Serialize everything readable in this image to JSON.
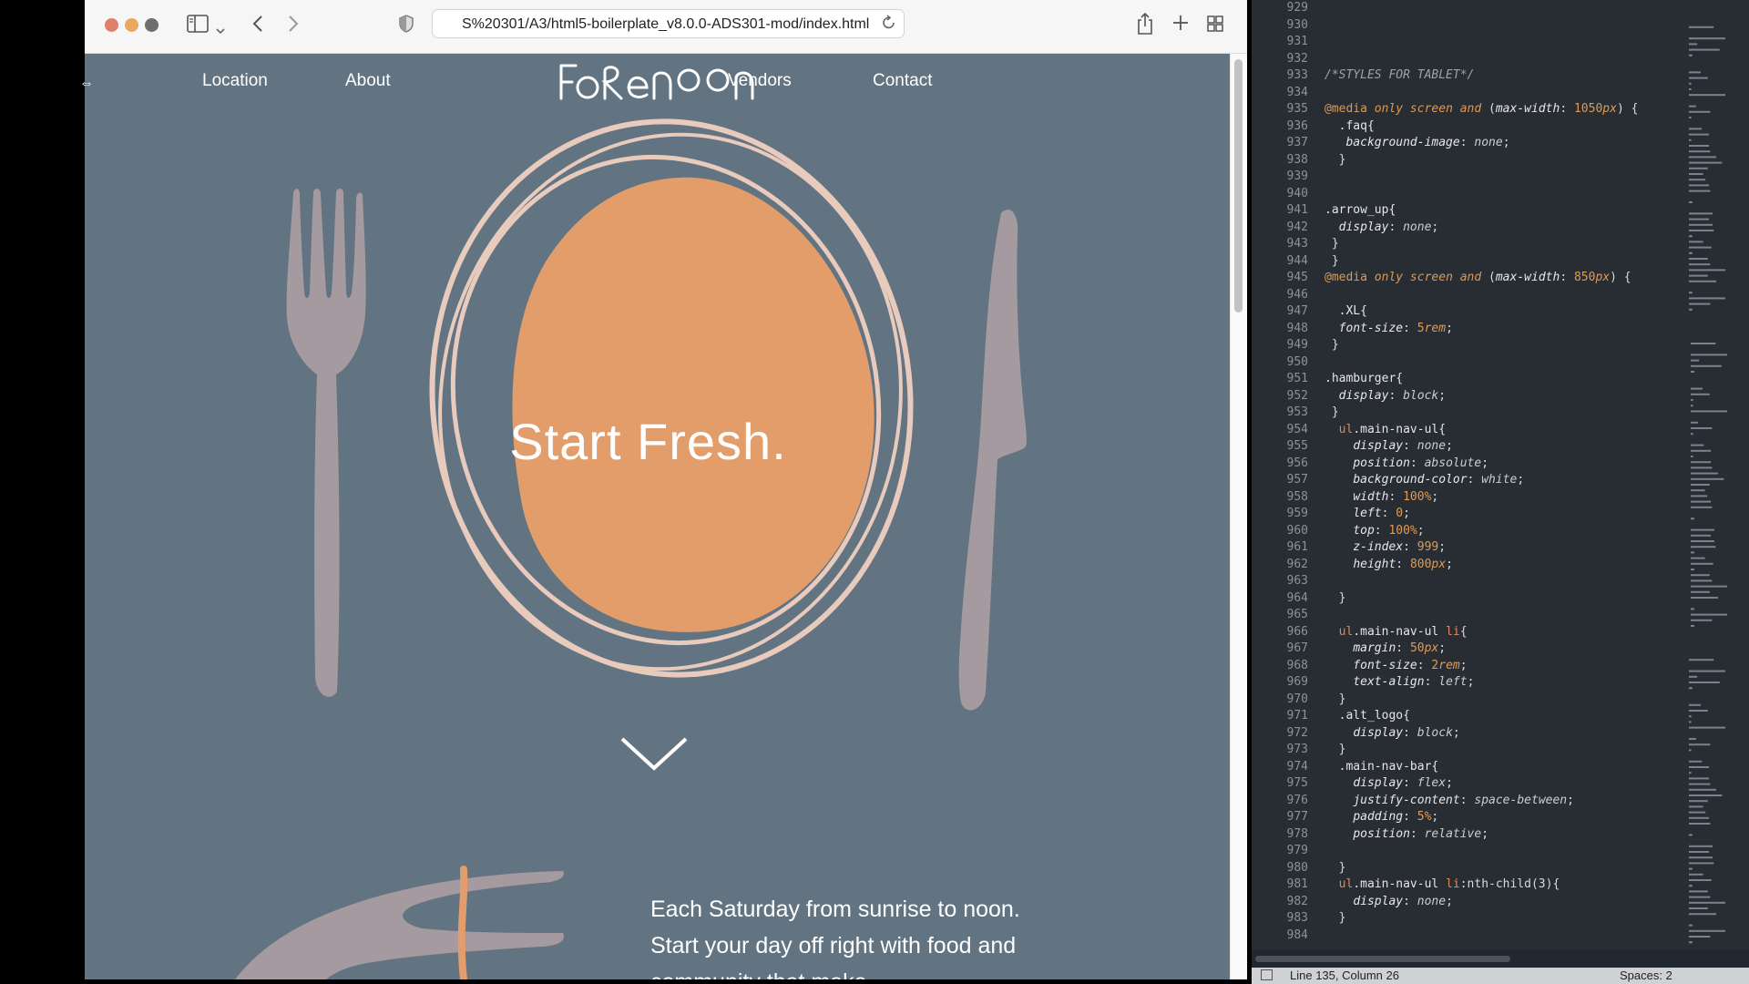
{
  "browser": {
    "url": "S%20301/A3/html5-boilerplate_v8.0.0-ADS301-mod/index.html",
    "traffic_colors": [
      "#e0806b",
      "#e9a85e",
      "#6e6e6e"
    ],
    "icons": {
      "sidebar": "sidebar-icon",
      "back": "chevron-left-icon",
      "forward": "chevron-right-icon",
      "privacy": "shield-icon",
      "reload": "reload-icon",
      "share": "share-icon",
      "new_tab": "plus-icon",
      "tabs": "grid-icon"
    }
  },
  "site": {
    "nav": {
      "location": "Location",
      "about": "About",
      "vendors": "Vendors",
      "contact": "Contact"
    },
    "logo_text": "FoReNoon",
    "hero_title": "Start Fresh.",
    "intro_text": "Each Saturday from sunrise to noon. Start your day off right with food and community that make",
    "colors": {
      "background": "#627482",
      "accent": "#e39d6b",
      "cutlery": "#a59a9f",
      "plate": "#e9cbbd"
    }
  },
  "editor": {
    "lines": [
      {
        "n": "929",
        "c": []
      },
      {
        "n": "930",
        "c": []
      },
      {
        "n": "931",
        "c": []
      },
      {
        "n": "932",
        "c": []
      },
      {
        "n": "933",
        "c": [
          [
            "c-com",
            "/*STYLES FOR TABLET*/"
          ]
        ]
      },
      {
        "n": "934",
        "c": []
      },
      {
        "n": "935",
        "c": [
          [
            "c-at",
            "@media "
          ],
          [
            "c-kw",
            "only screen and "
          ],
          [
            "",
            "("
          ],
          [
            "c-prop",
            "max-width"
          ],
          [
            "",
            ": "
          ],
          [
            "c-num",
            "1050"
          ],
          [
            "c-unit",
            "px"
          ],
          [
            "",
            ") {"
          ]
        ]
      },
      {
        "n": "936",
        "c": [
          [
            "c-sel",
            "  .faq{"
          ]
        ]
      },
      {
        "n": "937",
        "c": [
          [
            "",
            "   "
          ],
          [
            "c-prop",
            "background-image"
          ],
          [
            "",
            ": "
          ],
          [
            "c-val",
            "none"
          ],
          [
            "",
            ";"
          ]
        ]
      },
      {
        "n": "938",
        "c": [
          [
            "",
            "  }"
          ]
        ]
      },
      {
        "n": "939",
        "c": []
      },
      {
        "n": "940",
        "c": []
      },
      {
        "n": "941",
        "c": [
          [
            "c-sel",
            ".arrow_up{"
          ]
        ]
      },
      {
        "n": "942",
        "c": [
          [
            "",
            "  "
          ],
          [
            "c-prop",
            "display"
          ],
          [
            "",
            ": "
          ],
          [
            "c-val",
            "none"
          ],
          [
            "",
            ";"
          ]
        ]
      },
      {
        "n": "943",
        "c": [
          [
            "",
            " }"
          ]
        ]
      },
      {
        "n": "944",
        "c": [
          [
            "",
            " }"
          ]
        ]
      },
      {
        "n": "945",
        "c": [
          [
            "c-at",
            "@media "
          ],
          [
            "c-kw",
            "only screen and "
          ],
          [
            "",
            "("
          ],
          [
            "c-prop",
            "max-width"
          ],
          [
            "",
            ": "
          ],
          [
            "c-num",
            "850"
          ],
          [
            "c-unit",
            "px"
          ],
          [
            "",
            ") {"
          ]
        ]
      },
      {
        "n": "946",
        "c": []
      },
      {
        "n": "947",
        "c": [
          [
            "c-sel",
            "  .XL{"
          ]
        ]
      },
      {
        "n": "948",
        "c": [
          [
            "",
            "  "
          ],
          [
            "c-prop",
            "font-size"
          ],
          [
            "",
            ": "
          ],
          [
            "c-num",
            "5"
          ],
          [
            "c-unit",
            "rem"
          ],
          [
            "",
            ";"
          ]
        ]
      },
      {
        "n": "949",
        "c": [
          [
            "",
            " }"
          ]
        ]
      },
      {
        "n": "950",
        "c": []
      },
      {
        "n": "951",
        "c": [
          [
            "c-sel",
            ".hamburger{"
          ]
        ]
      },
      {
        "n": "952",
        "c": [
          [
            "",
            "  "
          ],
          [
            "c-prop",
            "display"
          ],
          [
            "",
            ": "
          ],
          [
            "c-val",
            "block"
          ],
          [
            "",
            ";"
          ]
        ]
      },
      {
        "n": "953",
        "c": [
          [
            "",
            " }"
          ]
        ]
      },
      {
        "n": "954",
        "c": [
          [
            "c-tag",
            "  ul"
          ],
          [
            "c-sel",
            ".main-nav-ul{"
          ]
        ]
      },
      {
        "n": "955",
        "c": [
          [
            "",
            "    "
          ],
          [
            "c-prop",
            "display"
          ],
          [
            "",
            ": "
          ],
          [
            "c-val",
            "none"
          ],
          [
            "",
            ";"
          ]
        ]
      },
      {
        "n": "956",
        "c": [
          [
            "",
            "    "
          ],
          [
            "c-prop",
            "position"
          ],
          [
            "",
            ": "
          ],
          [
            "c-val",
            "absolute"
          ],
          [
            "",
            ";"
          ]
        ]
      },
      {
        "n": "957",
        "c": [
          [
            "",
            "    "
          ],
          [
            "c-prop",
            "background-color"
          ],
          [
            "",
            ": "
          ],
          [
            "c-val",
            "white"
          ],
          [
            "",
            ";"
          ]
        ]
      },
      {
        "n": "958",
        "c": [
          [
            "",
            "    "
          ],
          [
            "c-prop",
            "width"
          ],
          [
            "",
            ": "
          ],
          [
            "c-num",
            "100"
          ],
          [
            "c-unit",
            "%"
          ],
          [
            "",
            ";"
          ]
        ]
      },
      {
        "n": "959",
        "c": [
          [
            "",
            "    "
          ],
          [
            "c-prop",
            "left"
          ],
          [
            "",
            ": "
          ],
          [
            "c-num",
            "0"
          ],
          [
            "",
            ";"
          ]
        ]
      },
      {
        "n": "960",
        "c": [
          [
            "",
            "    "
          ],
          [
            "c-prop",
            "top"
          ],
          [
            "",
            ": "
          ],
          [
            "c-num",
            "100"
          ],
          [
            "c-unit",
            "%"
          ],
          [
            "",
            ";"
          ]
        ]
      },
      {
        "n": "961",
        "c": [
          [
            "",
            "    "
          ],
          [
            "c-prop",
            "z-index"
          ],
          [
            "",
            ": "
          ],
          [
            "c-num",
            "999"
          ],
          [
            "",
            ";"
          ]
        ]
      },
      {
        "n": "962",
        "c": [
          [
            "",
            "    "
          ],
          [
            "c-prop",
            "height"
          ],
          [
            "",
            ": "
          ],
          [
            "c-num",
            "800"
          ],
          [
            "c-unit",
            "px"
          ],
          [
            "",
            ";"
          ]
        ]
      },
      {
        "n": "963",
        "c": []
      },
      {
        "n": "964",
        "c": [
          [
            "",
            "  }"
          ]
        ]
      },
      {
        "n": "965",
        "c": []
      },
      {
        "n": "966",
        "c": [
          [
            "c-tag",
            "  ul"
          ],
          [
            "c-sel",
            ".main-nav-ul "
          ],
          [
            "c-tag",
            "li"
          ],
          [
            "",
            "{"
          ]
        ]
      },
      {
        "n": "967",
        "c": [
          [
            "",
            "    "
          ],
          [
            "c-prop",
            "margin"
          ],
          [
            "",
            ": "
          ],
          [
            "c-num",
            "50"
          ],
          [
            "c-unit",
            "px"
          ],
          [
            "",
            ";"
          ]
        ]
      },
      {
        "n": "968",
        "c": [
          [
            "",
            "    "
          ],
          [
            "c-prop",
            "font-size"
          ],
          [
            "",
            ": "
          ],
          [
            "c-num",
            "2"
          ],
          [
            "c-unit",
            "rem"
          ],
          [
            "",
            ";"
          ]
        ]
      },
      {
        "n": "969",
        "c": [
          [
            "",
            "    "
          ],
          [
            "c-prop",
            "text-align"
          ],
          [
            "",
            ": "
          ],
          [
            "c-val",
            "left"
          ],
          [
            "",
            ";"
          ]
        ]
      },
      {
        "n": "970",
        "c": [
          [
            "",
            "  }"
          ]
        ]
      },
      {
        "n": "971",
        "c": [
          [
            "c-sel",
            "  .alt_logo{"
          ]
        ]
      },
      {
        "n": "972",
        "c": [
          [
            "",
            "    "
          ],
          [
            "c-prop",
            "display"
          ],
          [
            "",
            ": "
          ],
          [
            "c-val",
            "block"
          ],
          [
            "",
            ";"
          ]
        ]
      },
      {
        "n": "973",
        "c": [
          [
            "",
            "  }"
          ]
        ]
      },
      {
        "n": "974",
        "c": [
          [
            "c-sel",
            "  .main-nav-bar{"
          ]
        ]
      },
      {
        "n": "975",
        "c": [
          [
            "",
            "    "
          ],
          [
            "c-prop",
            "display"
          ],
          [
            "",
            ": "
          ],
          [
            "c-val",
            "flex"
          ],
          [
            "",
            ";"
          ]
        ]
      },
      {
        "n": "976",
        "c": [
          [
            "",
            "    "
          ],
          [
            "c-prop",
            "justify-content"
          ],
          [
            "",
            ": "
          ],
          [
            "c-val",
            "space-between"
          ],
          [
            "",
            ";"
          ]
        ]
      },
      {
        "n": "977",
        "c": [
          [
            "",
            "    "
          ],
          [
            "c-prop",
            "padding"
          ],
          [
            "",
            ": "
          ],
          [
            "c-num",
            "5"
          ],
          [
            "c-unit",
            "%"
          ],
          [
            "",
            ";"
          ]
        ]
      },
      {
        "n": "978",
        "c": [
          [
            "",
            "    "
          ],
          [
            "c-prop",
            "position"
          ],
          [
            "",
            ": "
          ],
          [
            "c-val",
            "relative"
          ],
          [
            "",
            ";"
          ]
        ]
      },
      {
        "n": "979",
        "c": []
      },
      {
        "n": "980",
        "c": [
          [
            "",
            "  }"
          ]
        ]
      },
      {
        "n": "981",
        "c": [
          [
            "c-tag",
            "  ul"
          ],
          [
            "c-sel",
            ".main-nav-ul "
          ],
          [
            "c-tag",
            "li"
          ],
          [
            "",
            ":nth-child(3){"
          ]
        ]
      },
      {
        "n": "982",
        "c": [
          [
            "",
            "    "
          ],
          [
            "c-prop",
            "display"
          ],
          [
            "",
            ": "
          ],
          [
            "c-val",
            "none"
          ],
          [
            "",
            ";"
          ]
        ]
      },
      {
        "n": "983",
        "c": [
          [
            "",
            "  }"
          ]
        ]
      },
      {
        "n": "984",
        "c": []
      }
    ]
  },
  "status": {
    "position": "Line 135, Column 26",
    "indent": "Spaces: 2"
  }
}
